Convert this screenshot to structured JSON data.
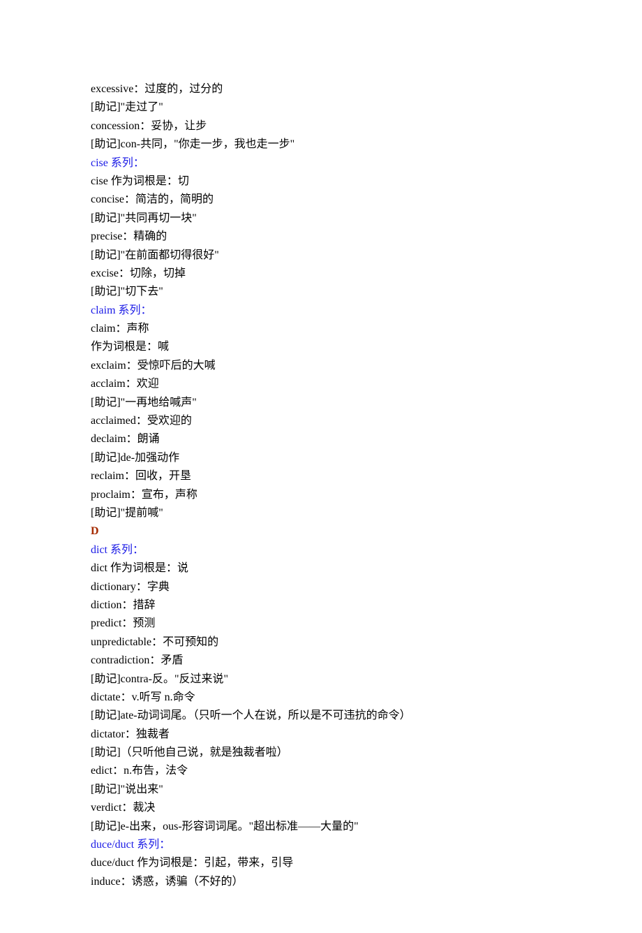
{
  "lines": [
    {
      "text": "excessive：过度的，过分的",
      "cls": ""
    },
    {
      "text": "[助记]\"走过了\"",
      "cls": ""
    },
    {
      "text": "concession：妥协，让步",
      "cls": ""
    },
    {
      "text": "[助记]con-共同，\"你走一步，我也走一步\"",
      "cls": ""
    },
    {
      "text": "cise 系列：",
      "cls": "heading-blue"
    },
    {
      "text": "cise 作为词根是：切",
      "cls": ""
    },
    {
      "text": "concise：简洁的，简明的",
      "cls": ""
    },
    {
      "text": "[助记]\"共同再切一块\"",
      "cls": ""
    },
    {
      "text": "precise：精确的",
      "cls": ""
    },
    {
      "text": "[助记]\"在前面都切得很好\"",
      "cls": ""
    },
    {
      "text": "excise：切除，切掉",
      "cls": ""
    },
    {
      "text": "[助记]\"切下去\"",
      "cls": ""
    },
    {
      "text": "claim 系列：",
      "cls": "heading-blue"
    },
    {
      "text": "claim：声称",
      "cls": ""
    },
    {
      "text": "作为词根是：喊",
      "cls": ""
    },
    {
      "text": "exclaim：受惊吓后的大喊",
      "cls": ""
    },
    {
      "text": "acclaim：欢迎",
      "cls": ""
    },
    {
      "text": "[助记]\"一再地给喊声\"",
      "cls": ""
    },
    {
      "text": "acclaimed：受欢迎的",
      "cls": ""
    },
    {
      "text": "declaim：朗诵",
      "cls": ""
    },
    {
      "text": "[助记]de-加强动作",
      "cls": ""
    },
    {
      "text": "reclaim：回收，开垦",
      "cls": ""
    },
    {
      "text": "proclaim：宣布，声称",
      "cls": ""
    },
    {
      "text": "[助记]\"提前喊\"",
      "cls": ""
    },
    {
      "text": "D",
      "cls": "heading-red"
    },
    {
      "text": "dict 系列：",
      "cls": "heading-blue"
    },
    {
      "text": "dict 作为词根是：说",
      "cls": ""
    },
    {
      "text": "dictionary：字典",
      "cls": ""
    },
    {
      "text": "diction：措辞",
      "cls": ""
    },
    {
      "text": "predict：预测",
      "cls": ""
    },
    {
      "text": "unpredictable：不可预知的",
      "cls": ""
    },
    {
      "text": "contradiction：矛盾",
      "cls": ""
    },
    {
      "text": "[助记]contra-反。\"反过来说\"",
      "cls": ""
    },
    {
      "text": "dictate：v.听写 n.命令",
      "cls": ""
    },
    {
      "text": "[助记]ate-动词词尾。（只听一个人在说，所以是不可违抗的命令）",
      "cls": ""
    },
    {
      "text": "dictator：独裁者",
      "cls": ""
    },
    {
      "text": "[助记]（只听他自己说，就是独裁者啦）",
      "cls": ""
    },
    {
      "text": "edict：n.布告，法令",
      "cls": ""
    },
    {
      "text": "[助记]\"说出来\"",
      "cls": ""
    },
    {
      "text": "verdict：裁决",
      "cls": ""
    },
    {
      "text": "[助记]e-出来，ous-形容词词尾。\"超出标准——大量的\"",
      "cls": ""
    },
    {
      "text": "duce/duct 系列：",
      "cls": "heading-blue"
    },
    {
      "text": "duce/duct 作为词根是：引起，带来，引导",
      "cls": ""
    },
    {
      "text": "induce：诱惑，诱骗（不好的）",
      "cls": ""
    }
  ]
}
